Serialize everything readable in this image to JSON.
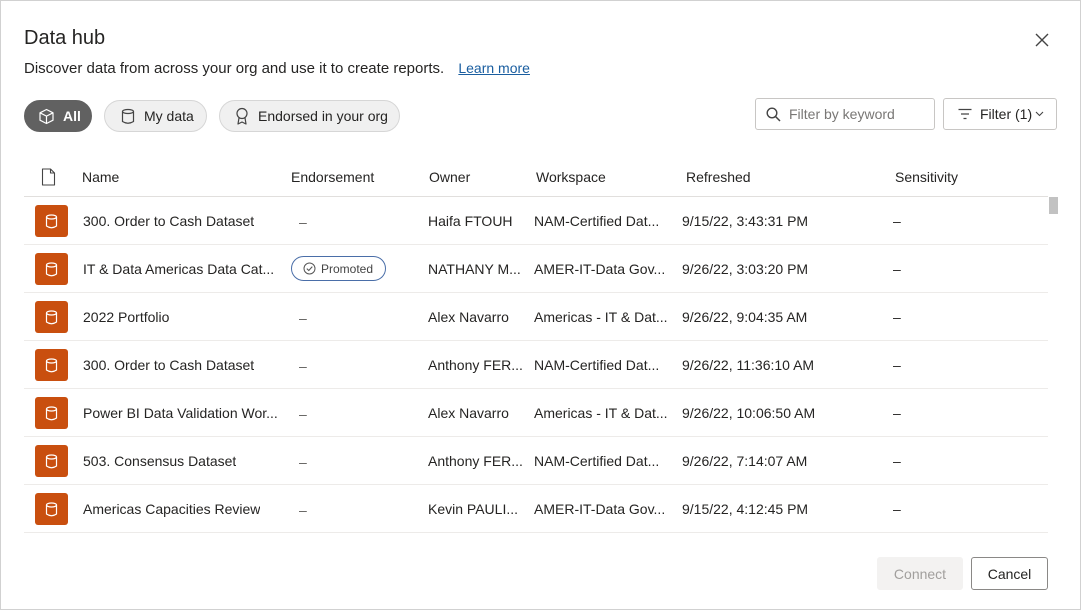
{
  "dialog": {
    "title": "Data hub",
    "subtitle": "Discover data from across your org and use it to create reports.",
    "learn_more": "Learn more"
  },
  "tabs": [
    {
      "label": "All",
      "icon": "cube-icon",
      "active": true
    },
    {
      "label": "My data",
      "icon": "database-icon",
      "active": false
    },
    {
      "label": "Endorsed in your org",
      "icon": "ribbon-icon",
      "active": false
    }
  ],
  "search": {
    "placeholder": "Filter by keyword",
    "value": ""
  },
  "filter": {
    "label": "Filter (1)"
  },
  "table": {
    "columns": {
      "name": "Name",
      "endorsement": "Endorsement",
      "owner": "Owner",
      "workspace": "Workspace",
      "refreshed": "Refreshed",
      "sensitivity": "Sensitivity"
    },
    "rows": [
      {
        "name": "300. Order to Cash Dataset",
        "endorsement": "–",
        "owner": "Haifa FTOUH",
        "workspace": "NAM-Certified Dat...",
        "refreshed": "9/15/22, 3:43:31 PM",
        "sensitivity": "–"
      },
      {
        "name": "IT & Data Americas Data Cat...",
        "endorsement": "Promoted",
        "owner": "NATHANY M...",
        "workspace": "AMER-IT-Data Gov...",
        "refreshed": "9/26/22, 3:03:20 PM",
        "sensitivity": "–"
      },
      {
        "name": "2022 Portfolio",
        "endorsement": "–",
        "owner": "Alex Navarro",
        "workspace": "Americas - IT & Dat...",
        "refreshed": "9/26/22, 9:04:35 AM",
        "sensitivity": "–"
      },
      {
        "name": "300. Order to Cash Dataset",
        "endorsement": "–",
        "owner": "Anthony FER...",
        "workspace": "NAM-Certified Dat...",
        "refreshed": "9/26/22, 11:36:10 AM",
        "sensitivity": "–"
      },
      {
        "name": "Power BI Data Validation Wor...",
        "endorsement": "–",
        "owner": "Alex Navarro",
        "workspace": "Americas - IT & Dat...",
        "refreshed": "9/26/22, 10:06:50 AM",
        "sensitivity": "–"
      },
      {
        "name": "503. Consensus Dataset",
        "endorsement": "–",
        "owner": "Anthony FER...",
        "workspace": "NAM-Certified Dat...",
        "refreshed": "9/26/22, 7:14:07 AM",
        "sensitivity": "–"
      },
      {
        "name": "Americas Capacities Review",
        "endorsement": "–",
        "owner": "Kevin PAULI...",
        "workspace": "AMER-IT-Data Gov...",
        "refreshed": "9/15/22, 4:12:45 PM",
        "sensitivity": "–"
      }
    ]
  },
  "footer": {
    "connect": "Connect",
    "cancel": "Cancel"
  },
  "colors": {
    "dataset_icon": "#c94f0f",
    "active_pill": "#616161",
    "link": "#1a5ea0"
  }
}
